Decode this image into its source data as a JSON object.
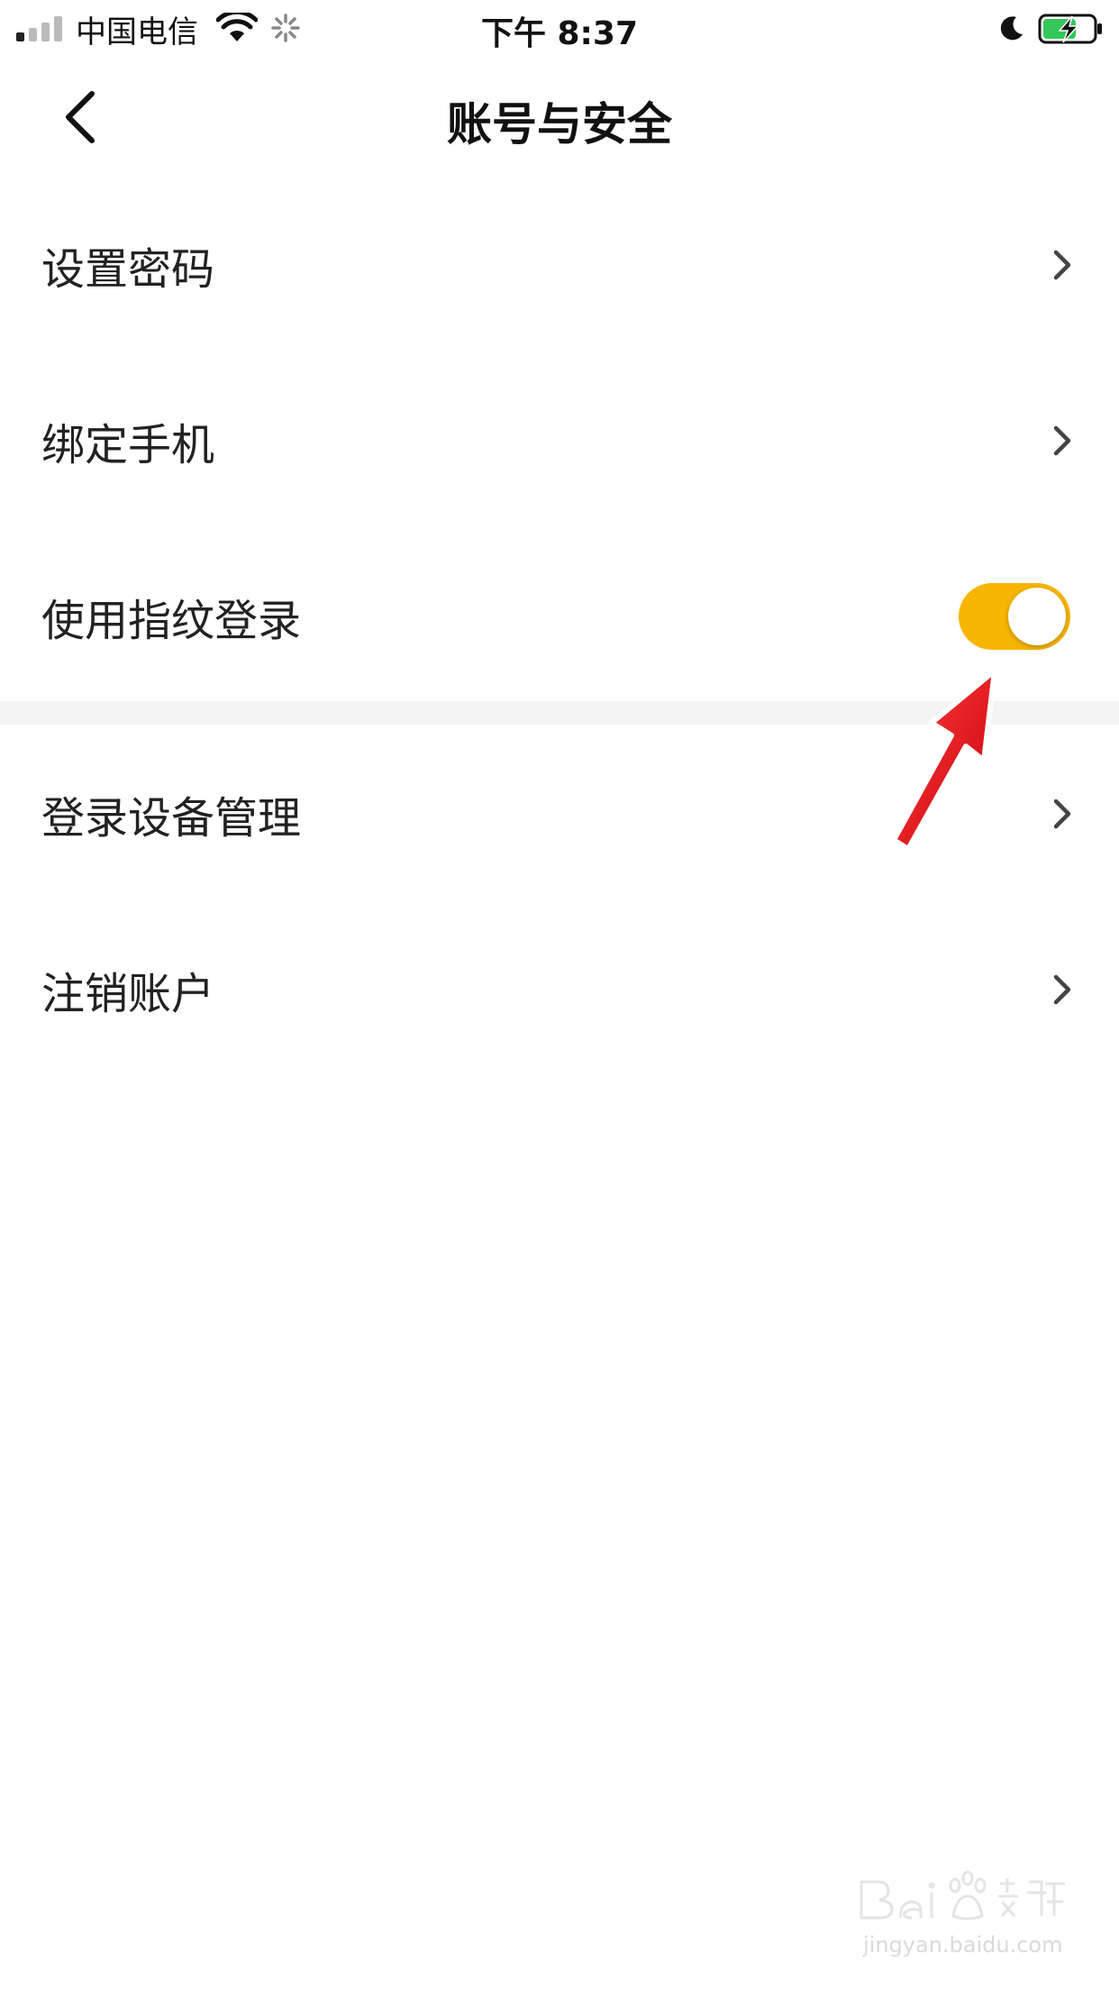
{
  "status_bar": {
    "carrier": "中国电信",
    "time": "下午 8:37"
  },
  "nav": {
    "title": "账号与安全"
  },
  "settings": {
    "set_password": "设置密码",
    "bind_phone": "绑定手机",
    "fingerprint_login": "使用指纹登录",
    "fingerprint_enabled": true,
    "device_management": "登录设备管理",
    "cancel_account": "注销账户"
  },
  "colors": {
    "accent": "#F7B500",
    "annotation_arrow": "#E8101A"
  },
  "watermark": {
    "url": "jingyan.baidu.com"
  }
}
